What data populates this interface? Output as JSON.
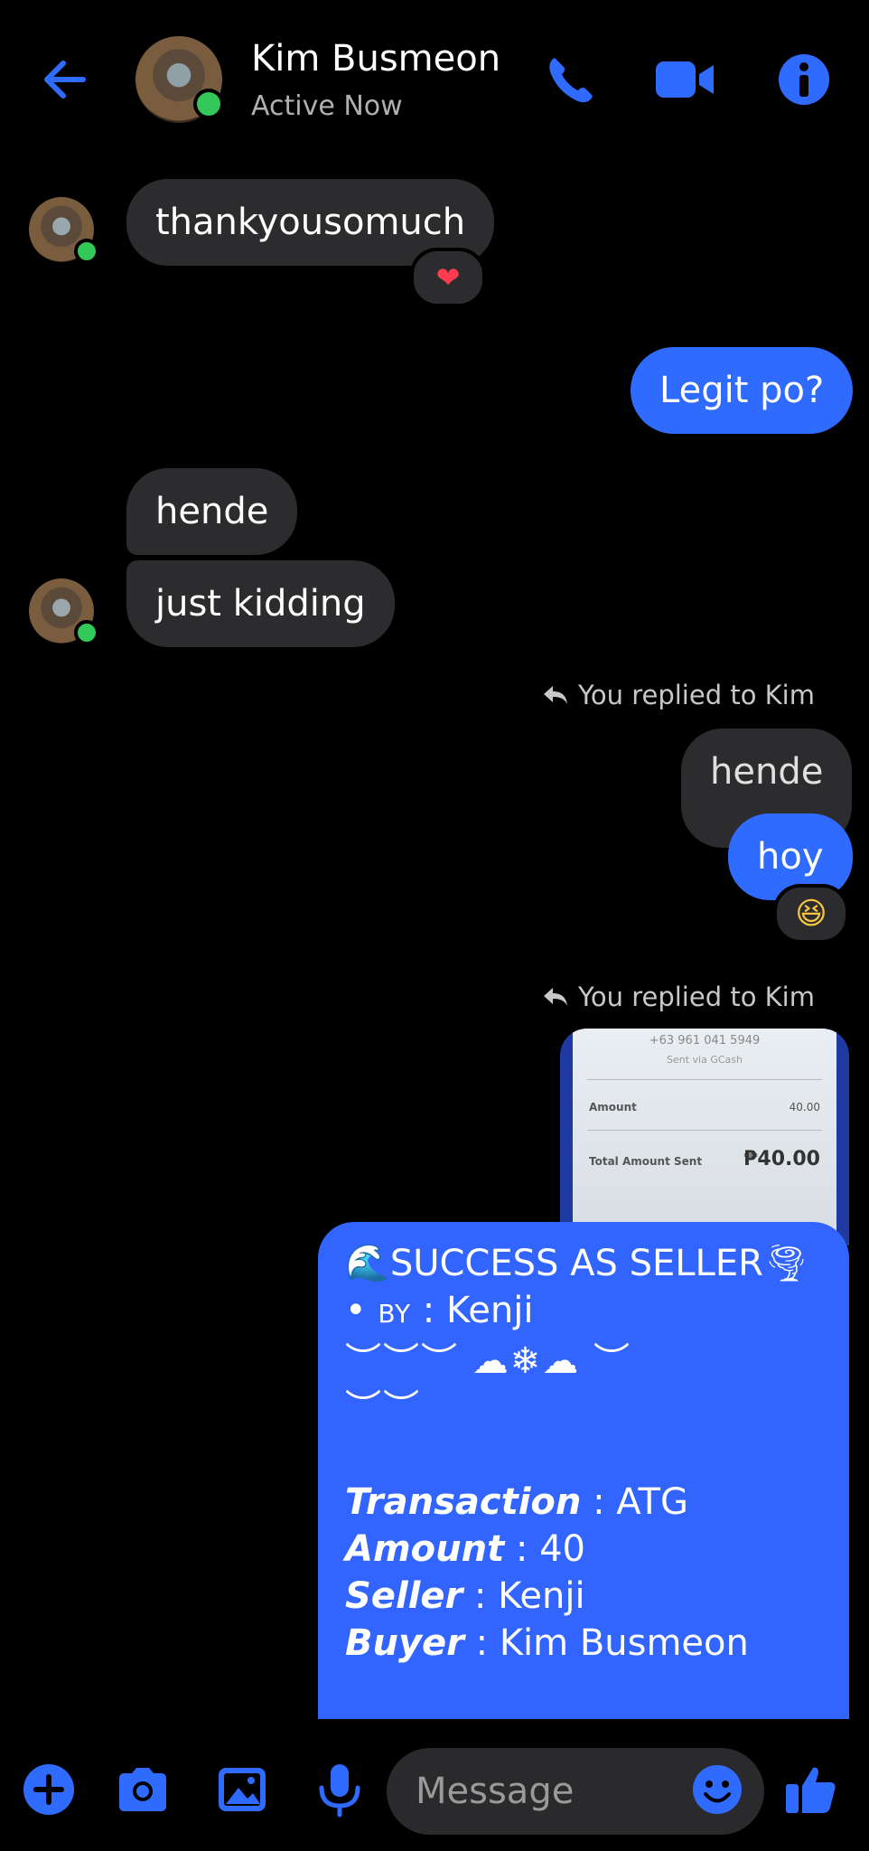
{
  "header": {
    "contact_name": "Kim Busmeon",
    "status": "Active Now"
  },
  "messages": {
    "m1": "thankyousomuch",
    "m1_reaction": "❤",
    "m2": "Legit po?",
    "m3": "hende",
    "m4": "just kidding",
    "reply_label_1": "You replied to Kim",
    "quoted_1": "hende",
    "m5": "hoy",
    "m5_reaction": "😆",
    "reply_label_2": "You replied to Kim"
  },
  "quoted_image": {
    "phone": "+63 961 041 5949",
    "sent_via": "Sent via GCash",
    "amount_label": "Amount",
    "amount_value": "40.00",
    "total_label": "Total Amount Sent",
    "total_value": "₱40.00"
  },
  "card": {
    "title": "SUCCESS AS SELLER",
    "title_emoji_left": "🌊",
    "title_emoji_right": "🌪",
    "by_prefix": "• ",
    "by_label": "BY",
    "by_value": " : Kenji",
    "deco_1": "︶︶︶ ☁❄☁ ︶",
    "deco_2": "︶︶",
    "transaction_label": "Transaction",
    "transaction_value": " : ATG",
    "amount_label": "Amount",
    "amount_value": " : 40",
    "seller_label": "Seller",
    "seller_value": " : Kenji",
    "buyer_label": "Buyer",
    "buyer_value": " : Kim Busmeon"
  },
  "composer": {
    "placeholder": "Message"
  },
  "colors": {
    "accent": "#2f6bff",
    "incoming_bubble": "#2c2c2e",
    "online": "#34c759"
  },
  "icons": [
    "back-arrow-icon",
    "phone-icon",
    "video-icon",
    "info-icon",
    "reply-icon",
    "plus-icon",
    "camera-icon",
    "gallery-icon",
    "mic-icon",
    "emoji-icon",
    "thumbs-up-icon"
  ]
}
